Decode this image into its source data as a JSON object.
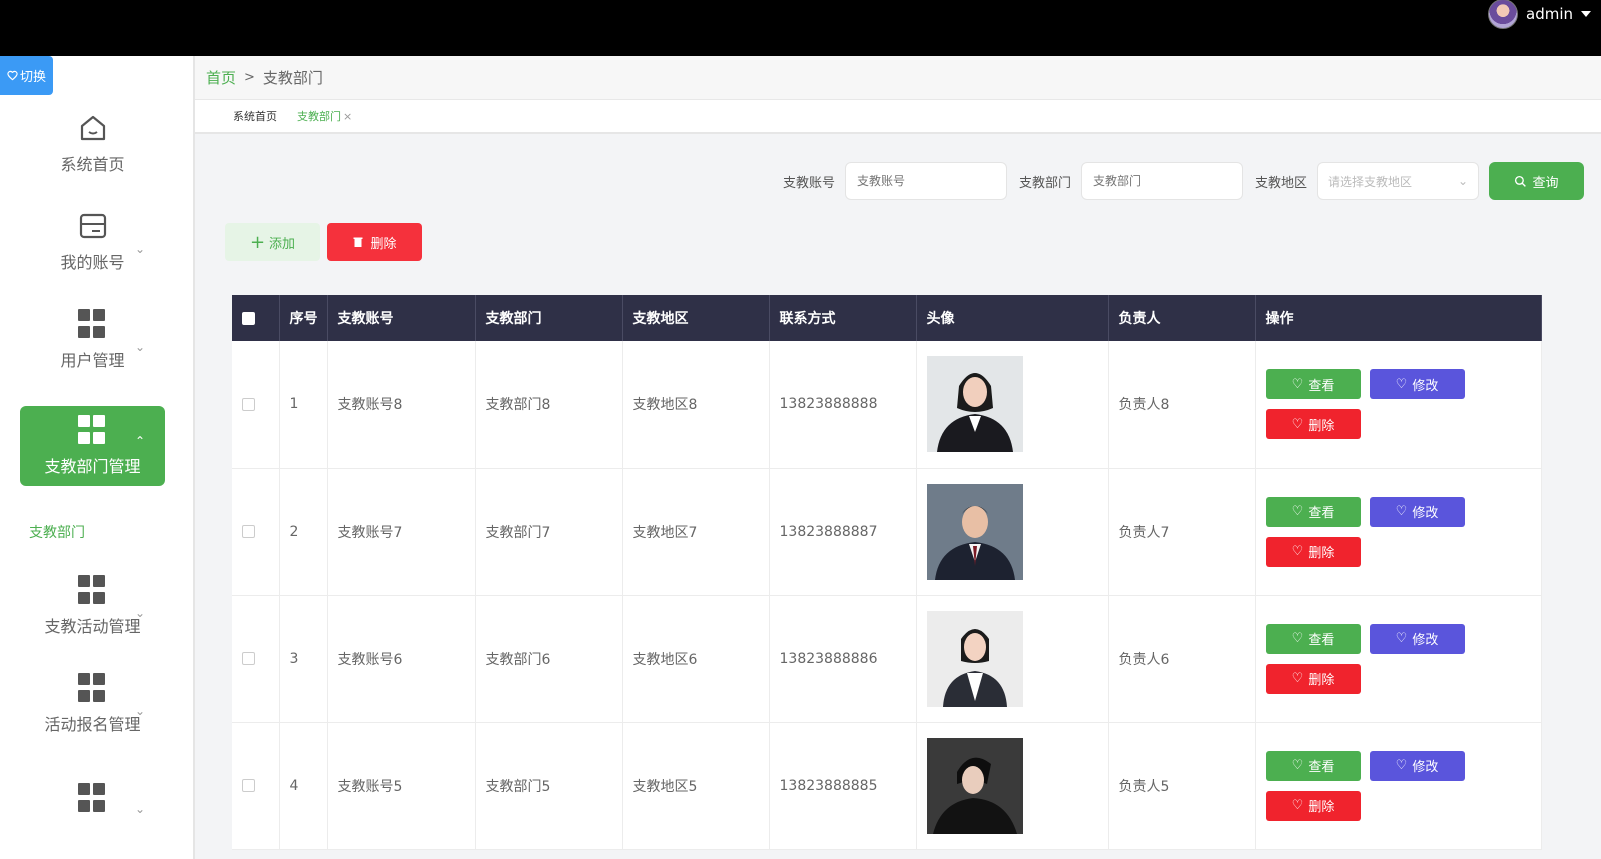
{
  "header": {
    "username": "admin"
  },
  "sidebar": {
    "switch_label": "切换",
    "items": [
      {
        "label": "系统首页",
        "icon": "home-icon"
      },
      {
        "label": "我的账号",
        "icon": "card-icon"
      },
      {
        "label": "用户管理",
        "icon": "grid-icon"
      },
      {
        "label": "支教部门管理",
        "icon": "grid-icon"
      },
      {
        "label": "支教活动管理",
        "icon": "grid-icon"
      },
      {
        "label": "活动报名管理",
        "icon": "grid-icon"
      },
      {
        "label": "",
        "icon": "grid-icon"
      }
    ],
    "sub_item": "支教部门"
  },
  "breadcrumb": {
    "home": "首页",
    "separator": ">",
    "current": "支教部门"
  },
  "tabs": [
    {
      "label": "系统首页"
    },
    {
      "label": "支教部门",
      "close": "×"
    }
  ],
  "search": {
    "account_label": "支教账号",
    "account_placeholder": "支教账号",
    "dept_label": "支教部门",
    "dept_placeholder": "支教部门",
    "region_label": "支教地区",
    "region_placeholder": "请选择支教地区",
    "query_label": "查询"
  },
  "toolbar": {
    "add_label": "添加",
    "delete_label": "删除"
  },
  "table": {
    "headers": [
      "",
      "序号",
      "支教账号",
      "支教部门",
      "支教地区",
      "联系方式",
      "头像",
      "负责人",
      "操作"
    ],
    "rows": [
      {
        "index": "1",
        "account": "支教账号8",
        "dept": "支教部门8",
        "region": "支教地区8",
        "phone": "13823888888",
        "manager": "负责人8"
      },
      {
        "index": "2",
        "account": "支教账号7",
        "dept": "支教部门7",
        "region": "支教地区7",
        "phone": "13823888887",
        "manager": "负责人7"
      },
      {
        "index": "3",
        "account": "支教账号6",
        "dept": "支教部门6",
        "region": "支教地区6",
        "phone": "13823888886",
        "manager": "负责人6"
      },
      {
        "index": "4",
        "account": "支教账号5",
        "dept": "支教部门5",
        "region": "支教地区5",
        "phone": "13823888885",
        "manager": "负责人5"
      }
    ],
    "actions": {
      "view": "查看",
      "edit": "修改",
      "delete": "删除"
    }
  },
  "colors": {
    "accent": "#4caf50",
    "danger": "#f0232d",
    "edit": "#5a55dc",
    "header_bg": "#2f3047"
  }
}
